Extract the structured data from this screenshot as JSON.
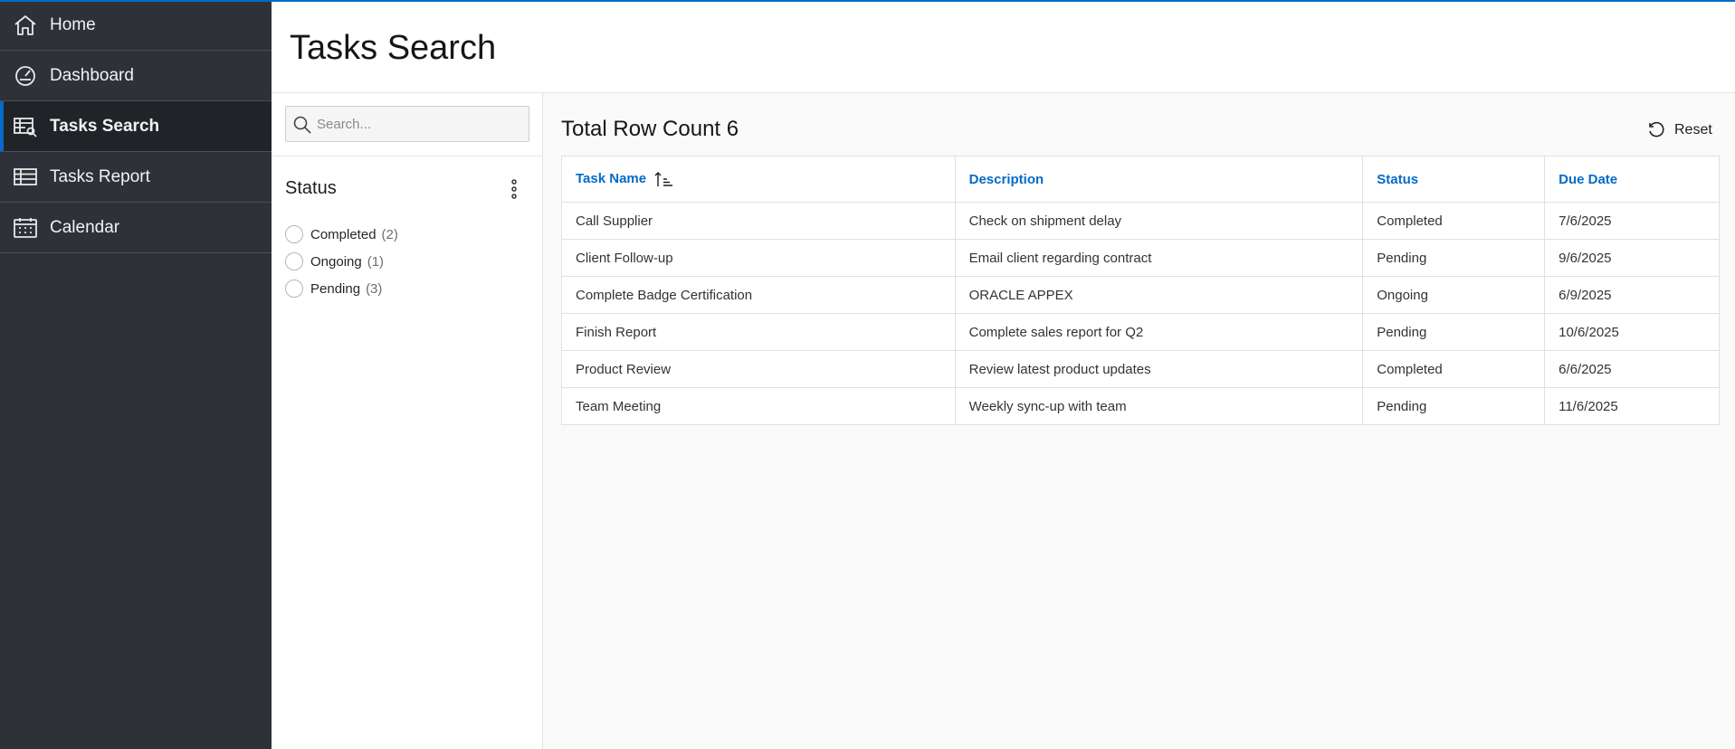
{
  "sidebar": {
    "items": [
      {
        "label": "Home",
        "icon": "home-icon",
        "active": false
      },
      {
        "label": "Dashboard",
        "icon": "dashboard-icon",
        "active": false
      },
      {
        "label": "Tasks Search",
        "icon": "table-search-icon",
        "active": true
      },
      {
        "label": "Tasks Report",
        "icon": "table-icon",
        "active": false
      },
      {
        "label": "Calendar",
        "icon": "calendar-icon",
        "active": false
      }
    ]
  },
  "header": {
    "title": "Tasks Search"
  },
  "facets": {
    "search": {
      "placeholder": "Search..."
    },
    "status": {
      "title": "Status",
      "options": [
        {
          "label": "Completed",
          "count": "(2)"
        },
        {
          "label": "Ongoing",
          "count": "(1)"
        },
        {
          "label": "Pending",
          "count": "(3)"
        }
      ]
    }
  },
  "results": {
    "row_count_label": "Total Row Count 6",
    "reset_label": "Reset",
    "columns": [
      "Task Name",
      "Description",
      "Status",
      "Due Date"
    ],
    "rows": [
      [
        "Call Supplier",
        "Check on shipment delay",
        "Completed",
        "7/6/2025"
      ],
      [
        "Client Follow-up",
        "Email client regarding contract",
        "Pending",
        "9/6/2025"
      ],
      [
        "Complete Badge Certification",
        "ORACLE APPEX",
        "Ongoing",
        "6/9/2025"
      ],
      [
        "Finish Report",
        "Complete sales report for Q2",
        "Pending",
        "10/6/2025"
      ],
      [
        "Product Review",
        "Review latest product updates",
        "Completed",
        "6/6/2025"
      ],
      [
        "Team Meeting",
        "Weekly sync-up with team",
        "Pending",
        "11/6/2025"
      ]
    ]
  },
  "colors": {
    "accent": "#056ac8",
    "sidebar_bg": "#2e3238",
    "sidebar_active_bg": "#202327"
  }
}
